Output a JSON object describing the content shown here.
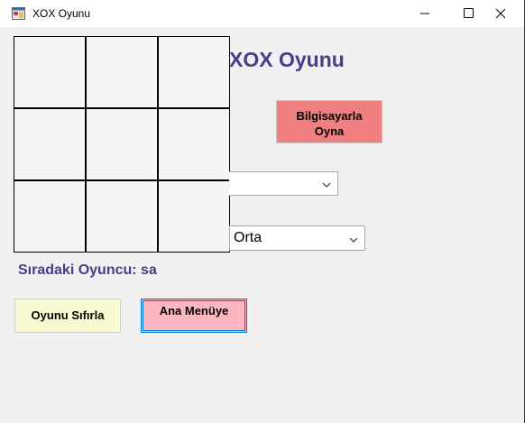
{
  "window": {
    "title": "XOX Oyunu",
    "controls": {
      "minimize": "minimize-icon",
      "maximize": "maximize-icon",
      "close": "close-icon"
    }
  },
  "board": {
    "cells": [
      "",
      "",
      "",
      "",
      "",
      "",
      "",
      "",
      ""
    ]
  },
  "heading": "XOX Oyunu",
  "buttons": {
    "play_computer_line1": "Bilgisayarla",
    "play_computer_line2": "Oyna",
    "reset": "Oyunu Sıfırla",
    "main_menu": "Ana Menüye"
  },
  "combos": {
    "first": "",
    "difficulty": "Orta"
  },
  "status": "Sıradaki Oyuncu: sa",
  "colors": {
    "heading": "#483d8b",
    "computer_button": "#f08080",
    "reset_button": "#fafad2",
    "menu_button": "#ffb6c1",
    "focus_border": "#0078d7"
  }
}
